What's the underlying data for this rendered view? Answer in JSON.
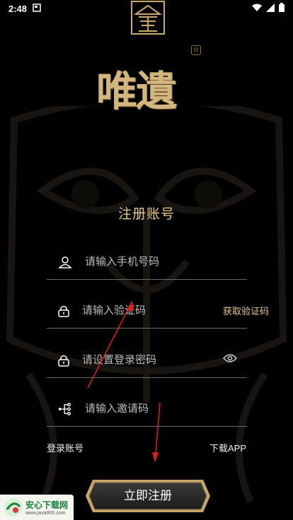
{
  "status_bar": {
    "time": "2:48"
  },
  "brand": {
    "title": "唯遺",
    "reg_mark": "R"
  },
  "page": {
    "title": "注册账号"
  },
  "form": {
    "phone": {
      "placeholder": "请输入手机号码",
      "icon": "user-icon"
    },
    "code": {
      "placeholder": "请输入验证码",
      "icon": "lock-icon",
      "action_label": "获取验证码"
    },
    "password": {
      "placeholder": "请设置登录密码",
      "icon": "lock-icon",
      "toggle_icon": "eye-icon"
    },
    "invite": {
      "placeholder": "请输入邀请码",
      "icon": "share-nodes-icon"
    }
  },
  "links": {
    "login": "登录账号",
    "download": "下载APP"
  },
  "submit": {
    "label": "立即注册"
  },
  "watermark": {
    "title": "安心下载网",
    "url": "www.java800.com"
  },
  "colors": {
    "accent_gold": "#e7c98c",
    "brand_gold": "#d2b67e",
    "annotation_red": "#e02020"
  }
}
